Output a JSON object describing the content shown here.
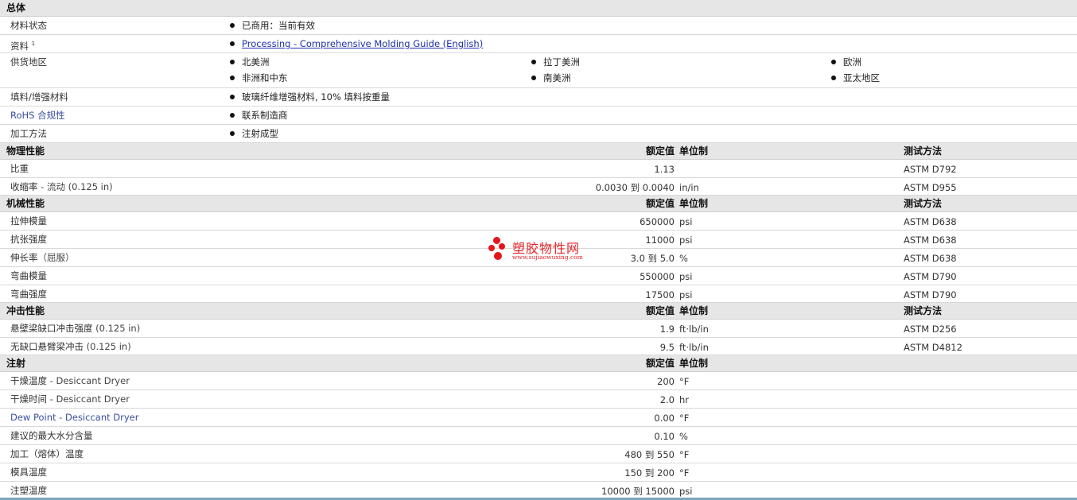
{
  "general": {
    "title": "总体",
    "status_label": "材料状态",
    "status_value": "已商用：当前有效",
    "docs_label": "资料",
    "docs_sup": "1",
    "docs_link": "Processing - Comprehensive Molding Guide (English)",
    "regions_label": "供货地区",
    "regions": [
      "北美洲",
      "拉丁美洲",
      "欧洲",
      "非洲和中东",
      "南美洲",
      "亚太地区"
    ],
    "filler_label": "填料/增强材料",
    "filler_value": "玻璃纤维增强材料, 10% 填料按重量",
    "rohs_label": "RoHS 合规性",
    "rohs_value": "联系制造商",
    "process_label": "加工方法",
    "process_value": "注射成型"
  },
  "headers": {
    "value": "额定值",
    "unit": "单位制",
    "test": "测试方法"
  },
  "physical": {
    "title": "物理性能",
    "rows": [
      {
        "label": "比重",
        "cond": "",
        "value": "1.13",
        "unit": "",
        "test": "ASTM D792"
      },
      {
        "label": "收缩率",
        "cond": " - 流动  (0.125 in)",
        "value": "0.0030 到  0.0040",
        "unit": "in/in",
        "test": "ASTM D955"
      }
    ]
  },
  "mechanical": {
    "title": "机械性能",
    "rows": [
      {
        "label": "拉伸模量",
        "cond": "",
        "value": "650000",
        "unit": "psi",
        "test": "ASTM D638"
      },
      {
        "label": "抗张强度",
        "cond": "",
        "value": "11000",
        "unit": "psi",
        "test": "ASTM D638"
      },
      {
        "label": "伸长率",
        "cond": "（屈服）",
        "value": "3.0 到  5.0",
        "unit": "%",
        "test": "ASTM D638"
      },
      {
        "label": "弯曲模量",
        "cond": "",
        "value": "550000",
        "unit": "psi",
        "test": "ASTM D790"
      },
      {
        "label": "弯曲强度",
        "cond": "",
        "value": "17500",
        "unit": "psi",
        "test": "ASTM D790"
      }
    ]
  },
  "impact": {
    "title": "冲击性能",
    "rows": [
      {
        "label": "悬壁梁缺口冲击强度",
        "cond": "  (0.125 in)",
        "value": "1.9",
        "unit": "ft·lb/in",
        "test": "ASTM D256"
      },
      {
        "label": "无缺口悬臂梁冲击",
        "cond": "  (0.125 in)",
        "value": "9.5",
        "unit": "ft·lb/in",
        "test": "ASTM D4812"
      }
    ]
  },
  "injection": {
    "title": "注射",
    "rows": [
      {
        "label": "干燥温度",
        "cond": "  - Desiccant Dryer",
        "value": "200",
        "unit": "°F"
      },
      {
        "label": "干燥时间",
        "cond": "  - Desiccant Dryer",
        "value": "2.0",
        "unit": "hr"
      },
      {
        "label": "Dew Point",
        "cond": " - Desiccant Dryer",
        "value": "0.00",
        "unit": "°F"
      },
      {
        "label": "建议的最大水分含量",
        "cond": "",
        "value": "0.10",
        "unit": "%"
      },
      {
        "label": "加工（熔体）温度",
        "cond": "",
        "value": "480 到  550",
        "unit": "°F"
      },
      {
        "label": "模具温度",
        "cond": "",
        "value": "150 到  200",
        "unit": "°F"
      },
      {
        "label": "注塑温度",
        "cond": "",
        "value": "10000 到  15000",
        "unit": "psi"
      }
    ]
  },
  "watermark": {
    "text": "塑胶物性网",
    "url": "www.sujiaowuxing.com",
    "color": "#e3252a"
  }
}
